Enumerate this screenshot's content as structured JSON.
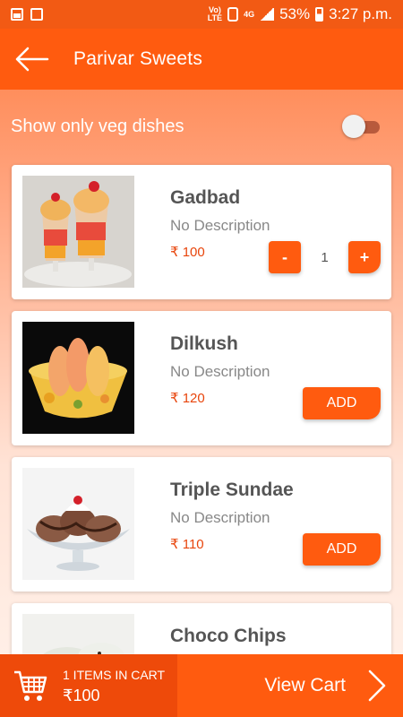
{
  "status_bar": {
    "network_top": "Vo)",
    "network_bottom": "LTE",
    "data_type": "4G",
    "battery": "53%",
    "time": "3:27 p.m."
  },
  "app_bar": {
    "title": "Parivar Sweets"
  },
  "veg_filter": {
    "label": "Show only veg dishes",
    "enabled": false
  },
  "currency": "₹",
  "dishes": [
    {
      "name": "Gadbad",
      "description": "No Description",
      "price": "₹ 100",
      "in_cart": true,
      "quantity": "1",
      "minus_label": "-",
      "plus_label": "+"
    },
    {
      "name": "Dilkush",
      "description": "No Description",
      "price": "₹ 120",
      "in_cart": false,
      "add_label": "ADD"
    },
    {
      "name": "Triple Sundae",
      "description": "No Description",
      "price": "₹ 110",
      "in_cart": false,
      "add_label": "ADD"
    },
    {
      "name": "Choco Chips"
    }
  ],
  "cart_bar": {
    "items_text": "1 ITEMS IN CART",
    "total": "₹100",
    "view_cart_label": "View Cart"
  },
  "colors": {
    "primary": "#ff5b0f",
    "status_bar": "#f25a14",
    "price": "#e8450c"
  }
}
